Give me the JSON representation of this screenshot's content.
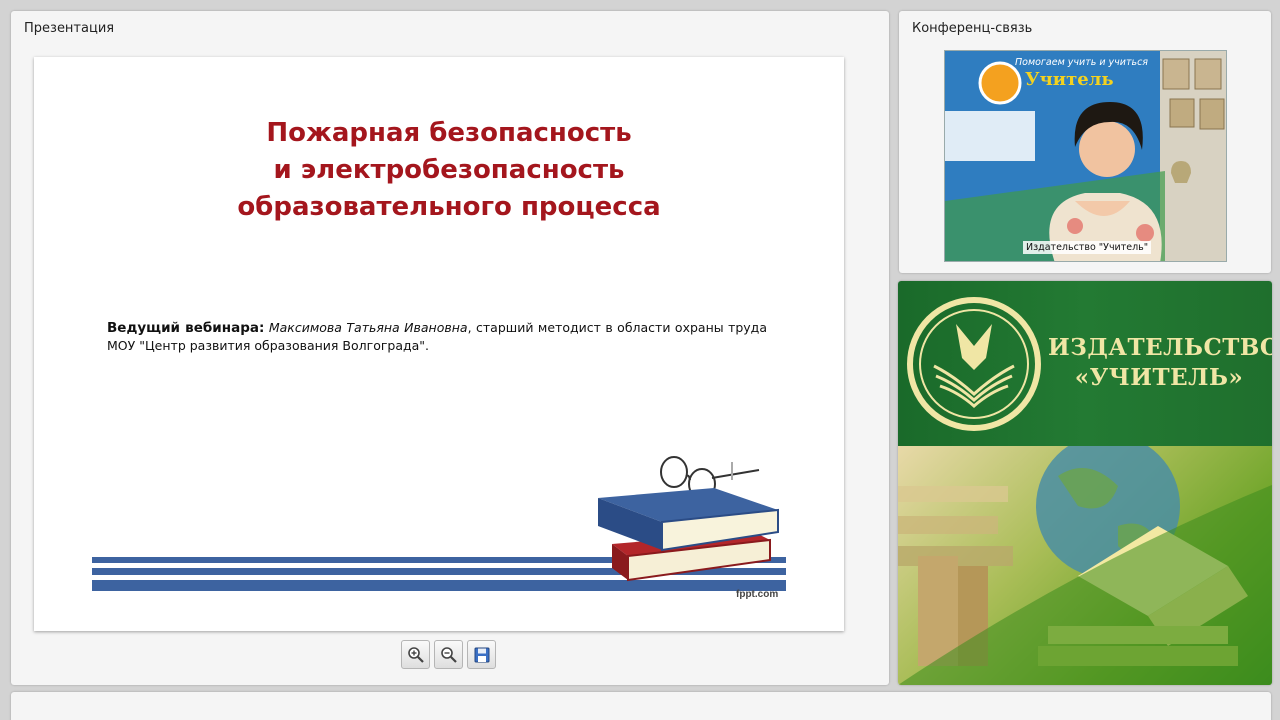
{
  "presentation": {
    "title": "Презентация",
    "slide": {
      "title_lines": [
        "Пожарная безопасность",
        "и электробезопасность",
        "образовательного процесса"
      ],
      "host_label": "Ведущий вебинара:",
      "host_name": "Максимова Татьяна Ивановна",
      "host_rest": ", старший методист в области охраны труда МОУ \"Центр развития образования Волгограда\".",
      "watermark": "fppt.com"
    },
    "toolbar": {
      "zoom_in_icon": "zoom-in-icon",
      "zoom_out_icon": "zoom-out-icon",
      "save_icon": "save-icon"
    }
  },
  "conference": {
    "title": "Конференц-связь",
    "video_label": "Издательство \"Учитель\"",
    "backdrop_text": [
      "Помогаем учить и учиться",
      "Учитель"
    ]
  },
  "brand": {
    "line1": "ИЗДАТЕЛЬСТВО",
    "line2": "«УЧИТЕЛЬ»",
    "accent_color": "#237a33",
    "text_color": "#f0e6a5"
  },
  "colors": {
    "slide_title": "#a4161d",
    "stripe": "#3d63a0"
  }
}
